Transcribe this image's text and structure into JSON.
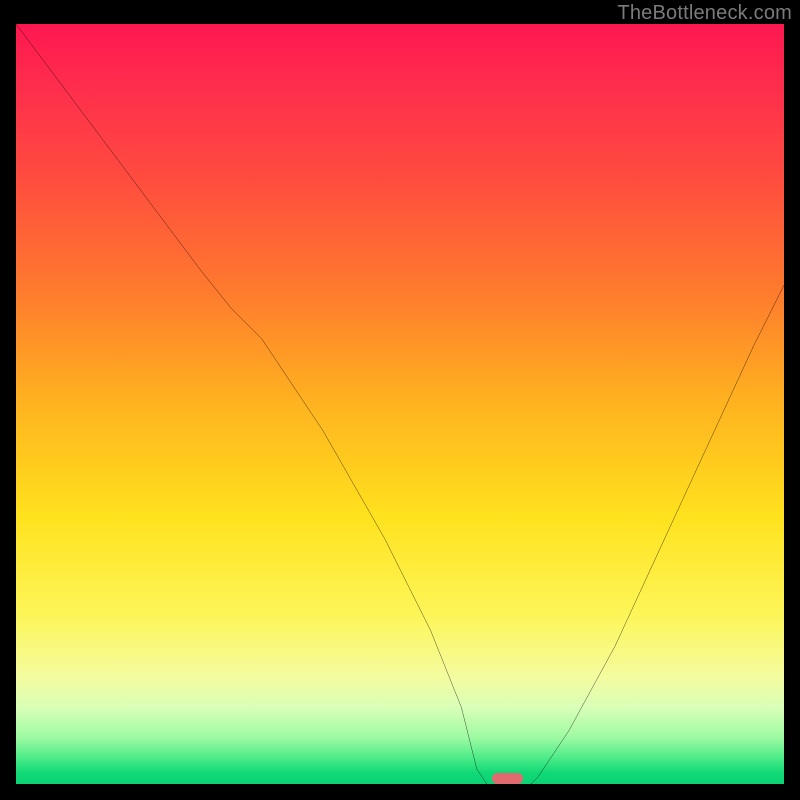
{
  "watermark": "TheBottleneck.com",
  "colors": {
    "background": "#000000",
    "curve": "#000000",
    "marker": "#e06a6d",
    "watermark_text": "#7b7b7b"
  },
  "chart_data": {
    "type": "line",
    "title": "",
    "xlabel": "",
    "ylabel": "",
    "xlim": [
      0,
      100
    ],
    "ylim": [
      0,
      100
    ],
    "grid": false,
    "note": "No numeric axis ticks or labels are rendered in the image; x/y values are normalized 0–100 estimates read from the plot area.",
    "series": [
      {
        "name": "bottleneck-curve",
        "x": [
          0,
          6,
          12,
          18,
          24,
          28,
          32,
          40,
          48,
          54,
          58,
          60,
          62,
          64,
          66,
          68,
          72,
          78,
          84,
          90,
          96,
          100
        ],
        "y": [
          100,
          92,
          84,
          76,
          68,
          63,
          59,
          47,
          33,
          21,
          11,
          3,
          0,
          0,
          0,
          2,
          8,
          19,
          32,
          45,
          58,
          66
        ]
      }
    ],
    "marker": {
      "name": "optimum-marker",
      "x_center": 64,
      "y": 0,
      "width_pct": 4,
      "color": "#e06a6d"
    },
    "background_gradient_stops": [
      {
        "pos": 0.0,
        "color": "#ff1750"
      },
      {
        "pos": 0.2,
        "color": "#ff4b3f"
      },
      {
        "pos": 0.5,
        "color": "#ffb31f"
      },
      {
        "pos": 0.78,
        "color": "#fdf65a"
      },
      {
        "pos": 0.94,
        "color": "#9bfaa2"
      },
      {
        "pos": 1.0,
        "color": "#0bd374"
      }
    ]
  }
}
